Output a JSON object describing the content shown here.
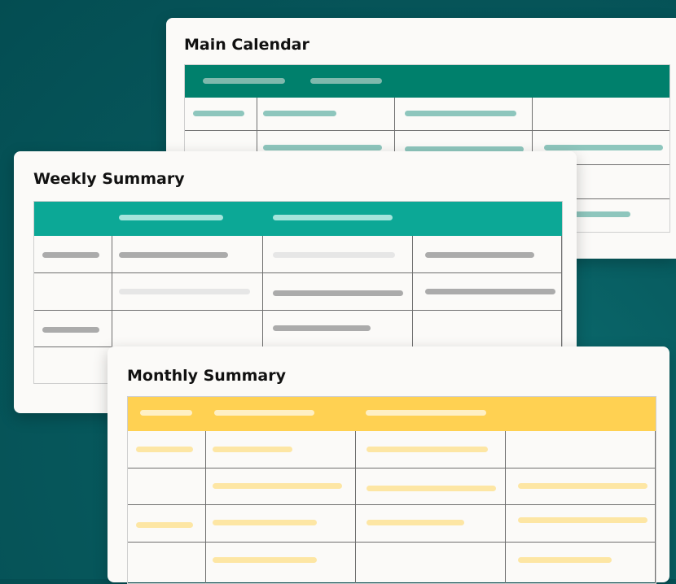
{
  "cards": {
    "main": {
      "title": "Main Calendar"
    },
    "weekly": {
      "title": "Weekly Summary"
    },
    "monthly": {
      "title": "Monthly Summary"
    }
  },
  "colors": {
    "background": "#055357",
    "main_header": "#00806c",
    "main_placeholder": "#8ec6bd",
    "main_header_placeholder": "#7fb9ad",
    "weekly_header": "#0ca896",
    "weekly_header_placeholder": "#a4e5dc",
    "weekly_placeholder_dark": "#ababab",
    "weekly_placeholder_light": "#e6e6e6",
    "monthly_header": "#ffd152",
    "monthly_header_placeholder": "#fff0c4",
    "monthly_placeholder": "#fde6a4",
    "card_background": "#fbfaf8",
    "grid_line": "#6f6f6f"
  }
}
